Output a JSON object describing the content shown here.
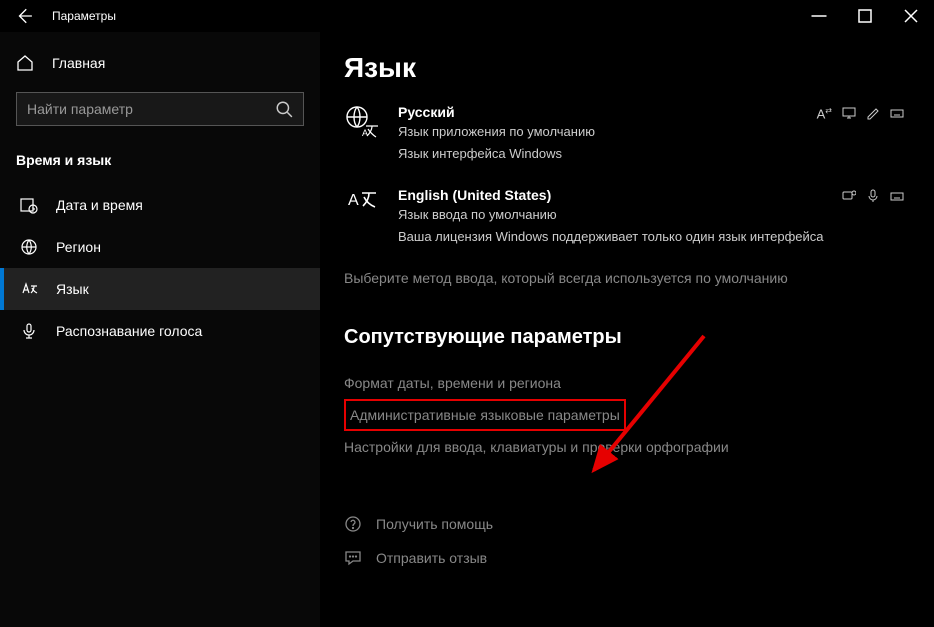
{
  "titlebar": {
    "title": "Параметры"
  },
  "sidebar": {
    "home": "Главная",
    "searchPlaceholder": "Найти параметр",
    "section": "Время и язык",
    "items": [
      {
        "label": "Дата и время"
      },
      {
        "label": "Регион"
      },
      {
        "label": "Язык"
      },
      {
        "label": "Распознавание голоса"
      }
    ]
  },
  "content": {
    "title": "Язык",
    "languages": [
      {
        "name": "Русский",
        "line1": "Язык приложения по умолчанию",
        "line2": "Язык интерфейса Windows"
      },
      {
        "name": "English (United States)",
        "line1": "Язык ввода по умолчанию",
        "line2": "Ваша лицензия Windows поддерживает только один язык интерфейса"
      }
    ],
    "hint": "Выберите метод ввода, который всегда используется по умолчанию",
    "relatedTitle": "Сопутствующие параметры",
    "relatedLinks": [
      "Формат даты, времени и региона",
      "Административные языковые параметры",
      "Настройки для ввода, клавиатуры и проверки орфографии"
    ],
    "footer": {
      "help": "Получить помощь",
      "feedback": "Отправить отзыв"
    }
  }
}
